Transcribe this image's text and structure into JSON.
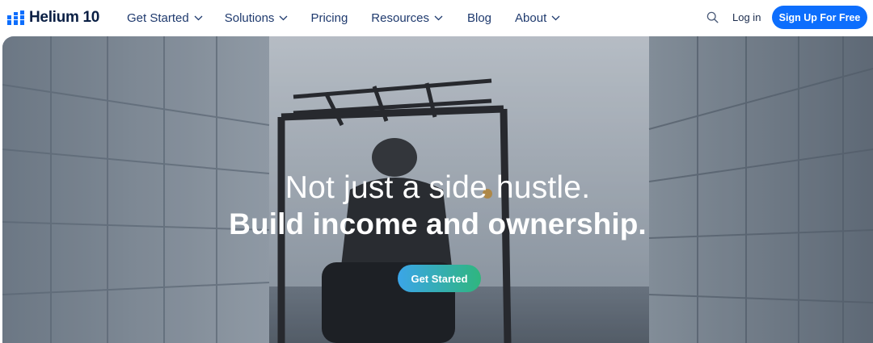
{
  "brand": {
    "name": "Helium 10",
    "logo_icon": "helium10-bars-logo"
  },
  "nav": {
    "items": [
      {
        "label": "Get Started",
        "has_dropdown": true
      },
      {
        "label": "Solutions",
        "has_dropdown": true
      },
      {
        "label": "Pricing",
        "has_dropdown": false
      },
      {
        "label": "Resources",
        "has_dropdown": true
      },
      {
        "label": "Blog",
        "has_dropdown": false
      },
      {
        "label": "About",
        "has_dropdown": true
      }
    ],
    "search_icon": "search-icon",
    "login_label": "Log in",
    "signup_label": "Sign Up For Free"
  },
  "hero": {
    "headline": "Not just a side hustle.",
    "subheadline": "Build income and ownership.",
    "cta_label": "Get Started"
  },
  "colors": {
    "brand_blue": "#0d6efd",
    "nav_text": "#1f3a6e",
    "logo_navy": "#0a1f44",
    "cta_gradient_start": "#3ba5e8",
    "cta_gradient_end": "#2fb67e"
  }
}
